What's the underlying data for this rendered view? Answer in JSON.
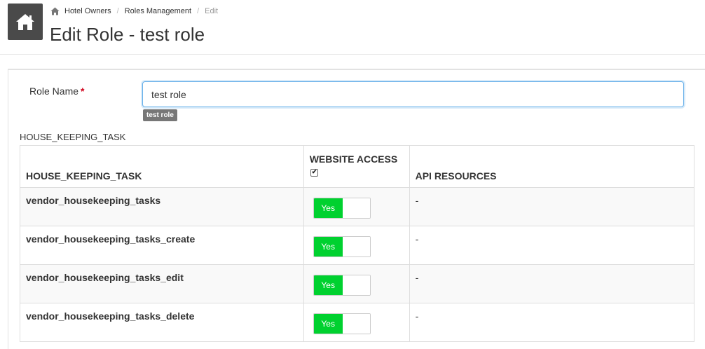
{
  "header": {
    "home_icon": "home-icon",
    "breadcrumb": {
      "icon": "home-icon",
      "items": [
        {
          "label": "Hotel Owners"
        },
        {
          "label": "Roles Management"
        },
        {
          "label": "Edit"
        }
      ]
    },
    "title": "Edit Role - test role"
  },
  "form": {
    "role_name_label": "Role Name",
    "required_mark": "*",
    "role_name_value": "test role",
    "role_name_badge": "test role"
  },
  "section_title": "HOUSE_KEEPING_TASK",
  "table": {
    "columns": [
      "HOUSE_KEEPING_TASK",
      "WEBSITE ACCESS",
      "API RESOURCES"
    ],
    "website_access_all_checked": true,
    "rows": [
      {
        "task": "vendor_housekeeping_tasks",
        "access": "Yes",
        "access_on": true,
        "api": "-"
      },
      {
        "task": "vendor_housekeeping_tasks_create",
        "access": "Yes",
        "access_on": true,
        "api": "-"
      },
      {
        "task": "vendor_housekeeping_tasks_edit",
        "access": "Yes",
        "access_on": true,
        "api": "-"
      },
      {
        "task": "vendor_housekeeping_tasks_delete",
        "access": "Yes",
        "access_on": true,
        "api": "-"
      }
    ]
  },
  "colors": {
    "switch_on": "#00d12f",
    "home_tile": "#4a4a4a",
    "required": "#d0021b",
    "focus_border": "#66afe9"
  }
}
